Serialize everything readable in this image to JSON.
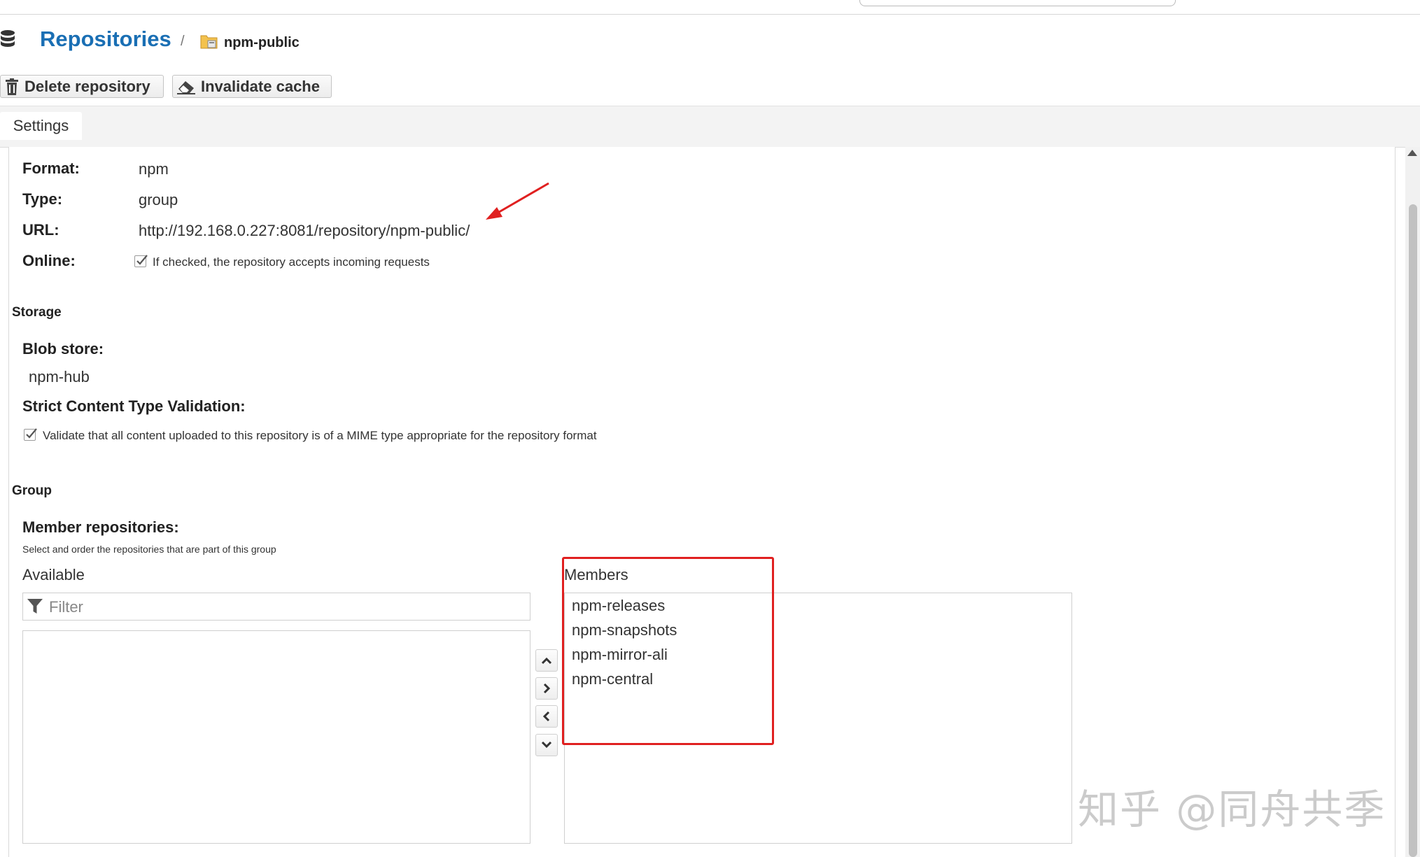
{
  "breadcrumb": {
    "title": "Repositories",
    "separator": "/",
    "repo": "npm-public",
    "icons": [
      "database-icon",
      "repository-folder-icon"
    ]
  },
  "toolbar": {
    "delete_label": "Delete repository",
    "invalidate_label": "Invalidate cache",
    "icons": [
      "trash-icon",
      "eraser-icon"
    ]
  },
  "tabs": [
    {
      "label": "Settings",
      "active": true
    }
  ],
  "settings": {
    "format_label": "Format:",
    "format_value": "npm",
    "type_label": "Type:",
    "type_value": "group",
    "url_label": "URL:",
    "url_value": "http://192.168.0.227:8081/repository/npm-public/",
    "online_label": "Online:",
    "online_checked": true,
    "online_help": "If checked, the repository accepts incoming requests"
  },
  "storage": {
    "section_title": "Storage",
    "blob_store_label": "Blob store:",
    "blob_store_value": "npm-hub",
    "strict_label": "Strict Content Type Validation:",
    "strict_checked": true,
    "strict_help": "Validate that all content uploaded to this repository is of a MIME type appropriate for the repository format"
  },
  "group": {
    "section_title": "Group",
    "member_label": "Member repositories:",
    "member_help": "Select and order the repositories that are part of this group",
    "available_title": "Available",
    "filter_placeholder": "Filter",
    "members_title": "Members",
    "members": [
      "npm-releases",
      "npm-snapshots",
      "npm-mirror-ali",
      "npm-central"
    ],
    "move_buttons": [
      "chevron-up-icon",
      "chevron-right-icon",
      "chevron-left-icon",
      "chevron-down-icon"
    ]
  },
  "annotations": {
    "arrow_color": "#e02020",
    "highlight_color": "#e02020"
  },
  "watermark": "知乎 @同舟共季",
  "colors": {
    "link_blue": "#1a6fb4",
    "text": "#333333",
    "tabstrip_bg": "#f3f3f3"
  }
}
